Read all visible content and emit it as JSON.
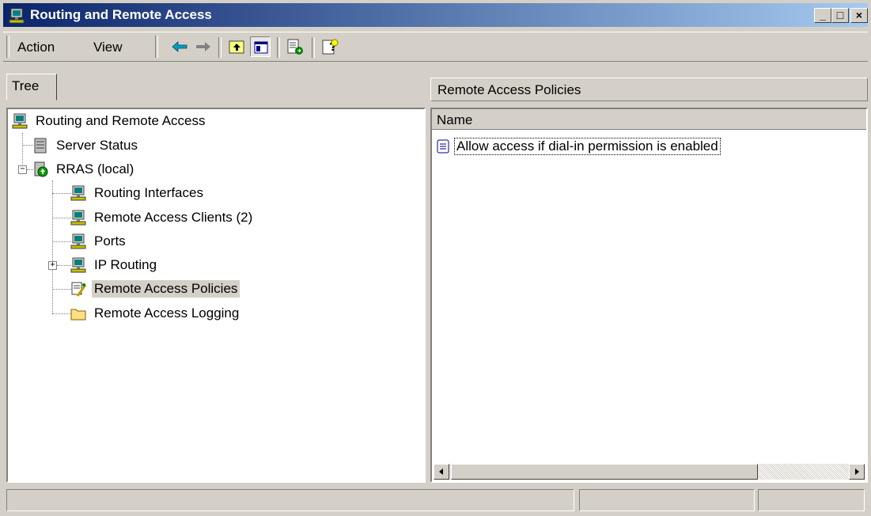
{
  "window": {
    "title": "Routing and Remote Access"
  },
  "title_buttons": {
    "minimize": "_",
    "maximize": "□",
    "close": "×"
  },
  "menu": {
    "action": "Action",
    "view": "View"
  },
  "toolbar": {
    "icons": [
      "back-arrow-icon",
      "forward-arrow-icon",
      "up-one-level-icon",
      "show-hide-tree-icon",
      "export-list-icon",
      "help-icon"
    ]
  },
  "tree": {
    "tab_label": "Tree",
    "items": [
      {
        "label": "Routing and Remote Access"
      },
      {
        "label": "Server Status"
      },
      {
        "label": "RRAS (local)"
      },
      {
        "label": "Routing Interfaces"
      },
      {
        "label": "Remote Access Clients (2)"
      },
      {
        "label": "Ports"
      },
      {
        "label": "IP Routing"
      },
      {
        "label": "Remote Access Policies"
      },
      {
        "label": "Remote Access Logging"
      }
    ],
    "expand_symbols": {
      "rras": "−",
      "ip_routing": "+"
    }
  },
  "details": {
    "header": "Remote Access Policies",
    "column_name": "Name",
    "rows": [
      {
        "name": "Allow access if dial-in permission is enabled"
      }
    ]
  },
  "colors": {
    "title_start": "#0a246a",
    "title_end": "#a6caf0",
    "face": "#d4d0c8"
  }
}
